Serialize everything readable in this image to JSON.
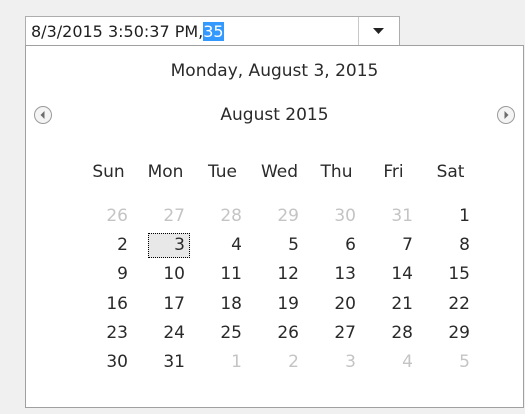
{
  "date_edit": {
    "text": "8/3/2015 3:50:37 PM,",
    "selected_text": "35"
  },
  "calendar": {
    "today_text": "Monday, August 3, 2015",
    "month_title": "August 2015",
    "weekdays": [
      "Sun",
      "Mon",
      "Tue",
      "Wed",
      "Thu",
      "Fri",
      "Sat"
    ],
    "days": [
      {
        "label": "26",
        "other": true
      },
      {
        "label": "27",
        "other": true
      },
      {
        "label": "28",
        "other": true
      },
      {
        "label": "29",
        "other": true
      },
      {
        "label": "30",
        "other": true
      },
      {
        "label": "31",
        "other": true
      },
      {
        "label": "1",
        "other": false
      },
      {
        "label": "2",
        "other": false
      },
      {
        "label": "3",
        "other": false,
        "today": true
      },
      {
        "label": "4",
        "other": false
      },
      {
        "label": "5",
        "other": false
      },
      {
        "label": "6",
        "other": false
      },
      {
        "label": "7",
        "other": false
      },
      {
        "label": "8",
        "other": false
      },
      {
        "label": "9",
        "other": false
      },
      {
        "label": "10",
        "other": false
      },
      {
        "label": "11",
        "other": false
      },
      {
        "label": "12",
        "other": false
      },
      {
        "label": "13",
        "other": false
      },
      {
        "label": "14",
        "other": false
      },
      {
        "label": "15",
        "other": false
      },
      {
        "label": "16",
        "other": false
      },
      {
        "label": "17",
        "other": false
      },
      {
        "label": "18",
        "other": false
      },
      {
        "label": "19",
        "other": false
      },
      {
        "label": "20",
        "other": false
      },
      {
        "label": "21",
        "other": false
      },
      {
        "label": "22",
        "other": false
      },
      {
        "label": "23",
        "other": false
      },
      {
        "label": "24",
        "other": false
      },
      {
        "label": "25",
        "other": false
      },
      {
        "label": "26",
        "other": false
      },
      {
        "label": "27",
        "other": false
      },
      {
        "label": "28",
        "other": false
      },
      {
        "label": "29",
        "other": false
      },
      {
        "label": "30",
        "other": false
      },
      {
        "label": "31",
        "other": false
      },
      {
        "label": "1",
        "other": true
      },
      {
        "label": "2",
        "other": true
      },
      {
        "label": "3",
        "other": true
      },
      {
        "label": "4",
        "other": true
      },
      {
        "label": "5",
        "other": true
      }
    ],
    "colors": {
      "selection": "#3399ff",
      "other_month": "#c4c4c4",
      "text": "#2a2a2a"
    }
  },
  "icons": {
    "dropdown": "chevron-down-icon",
    "prev": "prev-month-icon",
    "next": "next-month-icon"
  }
}
